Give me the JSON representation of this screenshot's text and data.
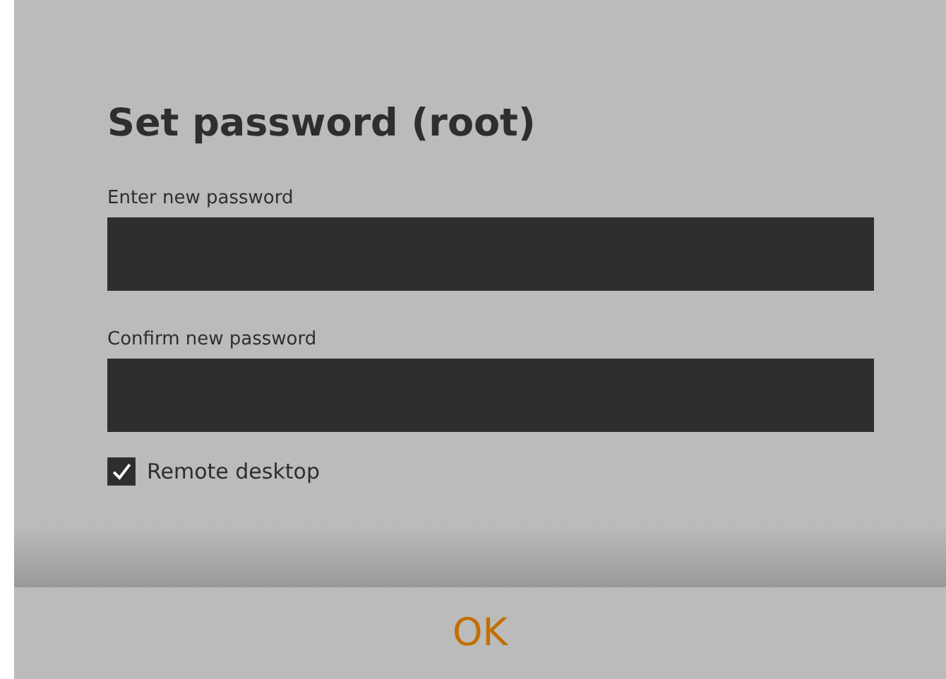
{
  "title": "Set password (root)",
  "fields": [
    {
      "label": "Enter new password"
    },
    {
      "label": "Confirm new password"
    }
  ],
  "remote_desktop": {
    "label": "Remote desktop",
    "checked": true
  },
  "ok_button": "OK"
}
